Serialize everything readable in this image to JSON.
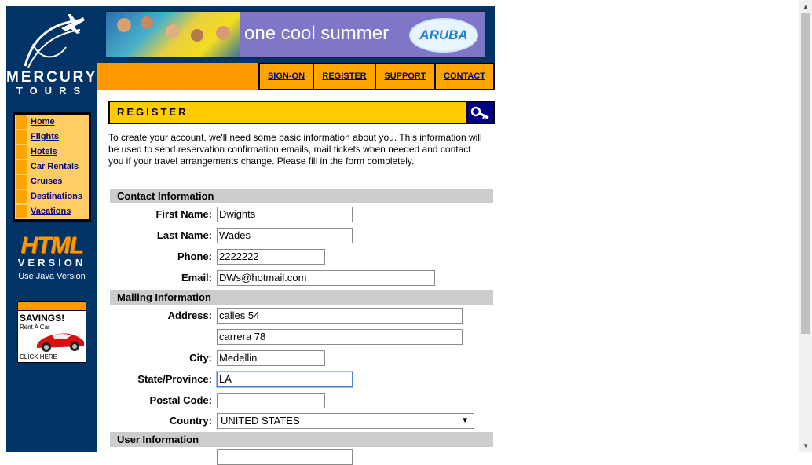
{
  "brand": {
    "line1": "MERCURY",
    "line2": "TOURS"
  },
  "nav": {
    "items": [
      {
        "label": "Home"
      },
      {
        "label": "Flights"
      },
      {
        "label": "Hotels"
      },
      {
        "label": "Car Rentals"
      },
      {
        "label": "Cruises"
      },
      {
        "label": "Destinations"
      },
      {
        "label": "Vacations"
      }
    ]
  },
  "badge": {
    "html": "HTML",
    "version": "VERSION",
    "java_link": "Use Java Version"
  },
  "ad": {
    "title": "SAVINGS!",
    "subtitle": "Rent A Car",
    "cta": "CLICK HERE"
  },
  "banner": {
    "slogan": "one cool summer",
    "destination": "ARUBA"
  },
  "topmenu": {
    "sign_on": "SIGN-ON",
    "register": "REGISTER",
    "support": "SUPPORT",
    "contact": "CONTACT"
  },
  "page": {
    "title": "REGISTER",
    "intro": "To create your account, we'll need some basic information about you. This information will be used to send reservation confirmation emails, mail tickets when needed and contact you if your travel arrangements change. Please fill in the form completely."
  },
  "form": {
    "contact_header": "Contact Information",
    "mailing_header": "Mailing Information",
    "user_header": "User Information",
    "first_name": {
      "label": "First Name:",
      "value": "Dwights"
    },
    "last_name": {
      "label": "Last Name:",
      "value": "Wades"
    },
    "phone": {
      "label": "Phone:",
      "value": "2222222"
    },
    "email": {
      "label": "Email:",
      "value": "DWs@hotmail.com"
    },
    "address": {
      "label": "Address:",
      "value1": "calles 54",
      "value2": "carrera 78"
    },
    "city": {
      "label": "City:",
      "value": "Medellin"
    },
    "state": {
      "label": "State/Province:",
      "value": "LA"
    },
    "postal": {
      "label": "Postal Code:",
      "value": ""
    },
    "country": {
      "label": "Country:",
      "value": "UNITED STATES"
    }
  },
  "colors": {
    "sidebar": "#003366",
    "accent_orange": "#ff9900",
    "nav_cell": "#ffcc66",
    "register_bar": "#ffcc00",
    "section_bar": "#cccccc",
    "link": "#000080"
  }
}
